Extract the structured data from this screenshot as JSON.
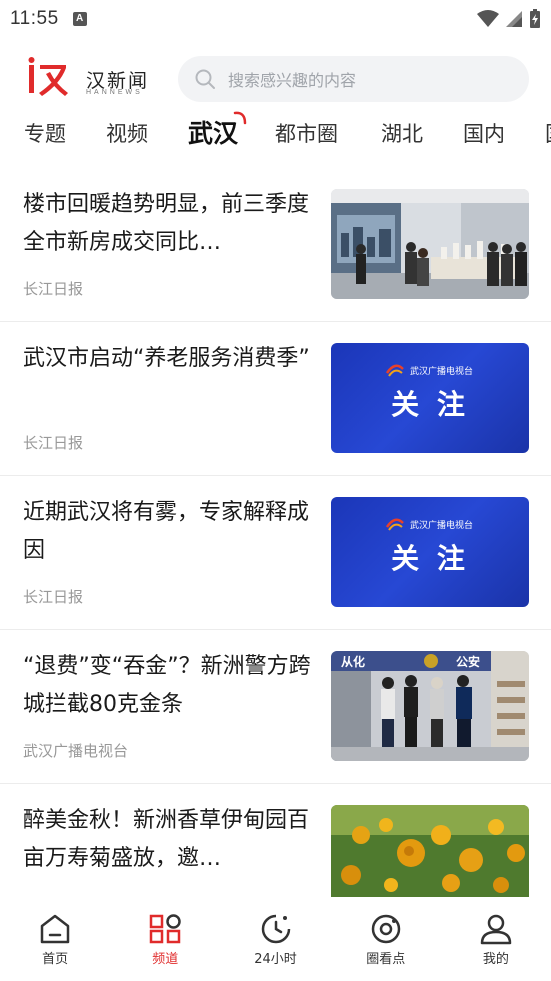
{
  "status_bar": {
    "time": "11:55",
    "notif_icon_letter": "A"
  },
  "header": {
    "logo_text": "汉新闻",
    "logo_sub": "HANNEWS",
    "search_placeholder": "搜索感兴趣的内容"
  },
  "tabs": [
    {
      "label": "专题",
      "active": false
    },
    {
      "label": "视频",
      "active": false
    },
    {
      "label": "武汉",
      "active": true
    },
    {
      "label": "都市圈",
      "active": false
    },
    {
      "label": "湖北",
      "active": false
    },
    {
      "label": "国内",
      "active": false
    },
    {
      "label": "国",
      "active": false
    }
  ],
  "articles": [
    {
      "title": "楼市回暖趋势明显，前三季度全市新房成交同比…",
      "source": "长江日报",
      "thumb": "property-showroom-photo"
    },
    {
      "title": "武汉市启动“养老服务消费季”",
      "source": "长江日报",
      "thumb": "follow-banner",
      "thumb_brand": "武汉广播电视台",
      "thumb_text": "关 注"
    },
    {
      "title": "近期武汉将有雾，专家解释成因",
      "source": "长江日报",
      "thumb": "follow-banner",
      "thumb_brand": "武汉广播电视台",
      "thumb_text": "关 注"
    },
    {
      "title": "“退费”变“吞金”？新洲警方跨城拦截80克金条",
      "source": "武汉广播电视台",
      "thumb": "police-station-photo",
      "thumb_sign_left": "从化",
      "thumb_sign_right": "公安"
    },
    {
      "title": "醉美金秋！新洲香草伊甸园百亩万寿菊盛放，邀…",
      "source": "",
      "thumb": "marigold-photo"
    }
  ],
  "bottom_nav": [
    {
      "label": "首页",
      "icon": "home-icon",
      "active": false
    },
    {
      "label": "频道",
      "icon": "channels-grid-icon",
      "active": true
    },
    {
      "label": "24小时",
      "icon": "clock-icon",
      "active": false
    },
    {
      "label": "圈看点",
      "icon": "circle-target-icon",
      "active": false
    },
    {
      "label": "我的",
      "icon": "user-icon",
      "active": false
    }
  ],
  "colors": {
    "brand_red": "#e02b2b",
    "banner_blue": "#1f3fc4",
    "text_gray": "#999999"
  }
}
